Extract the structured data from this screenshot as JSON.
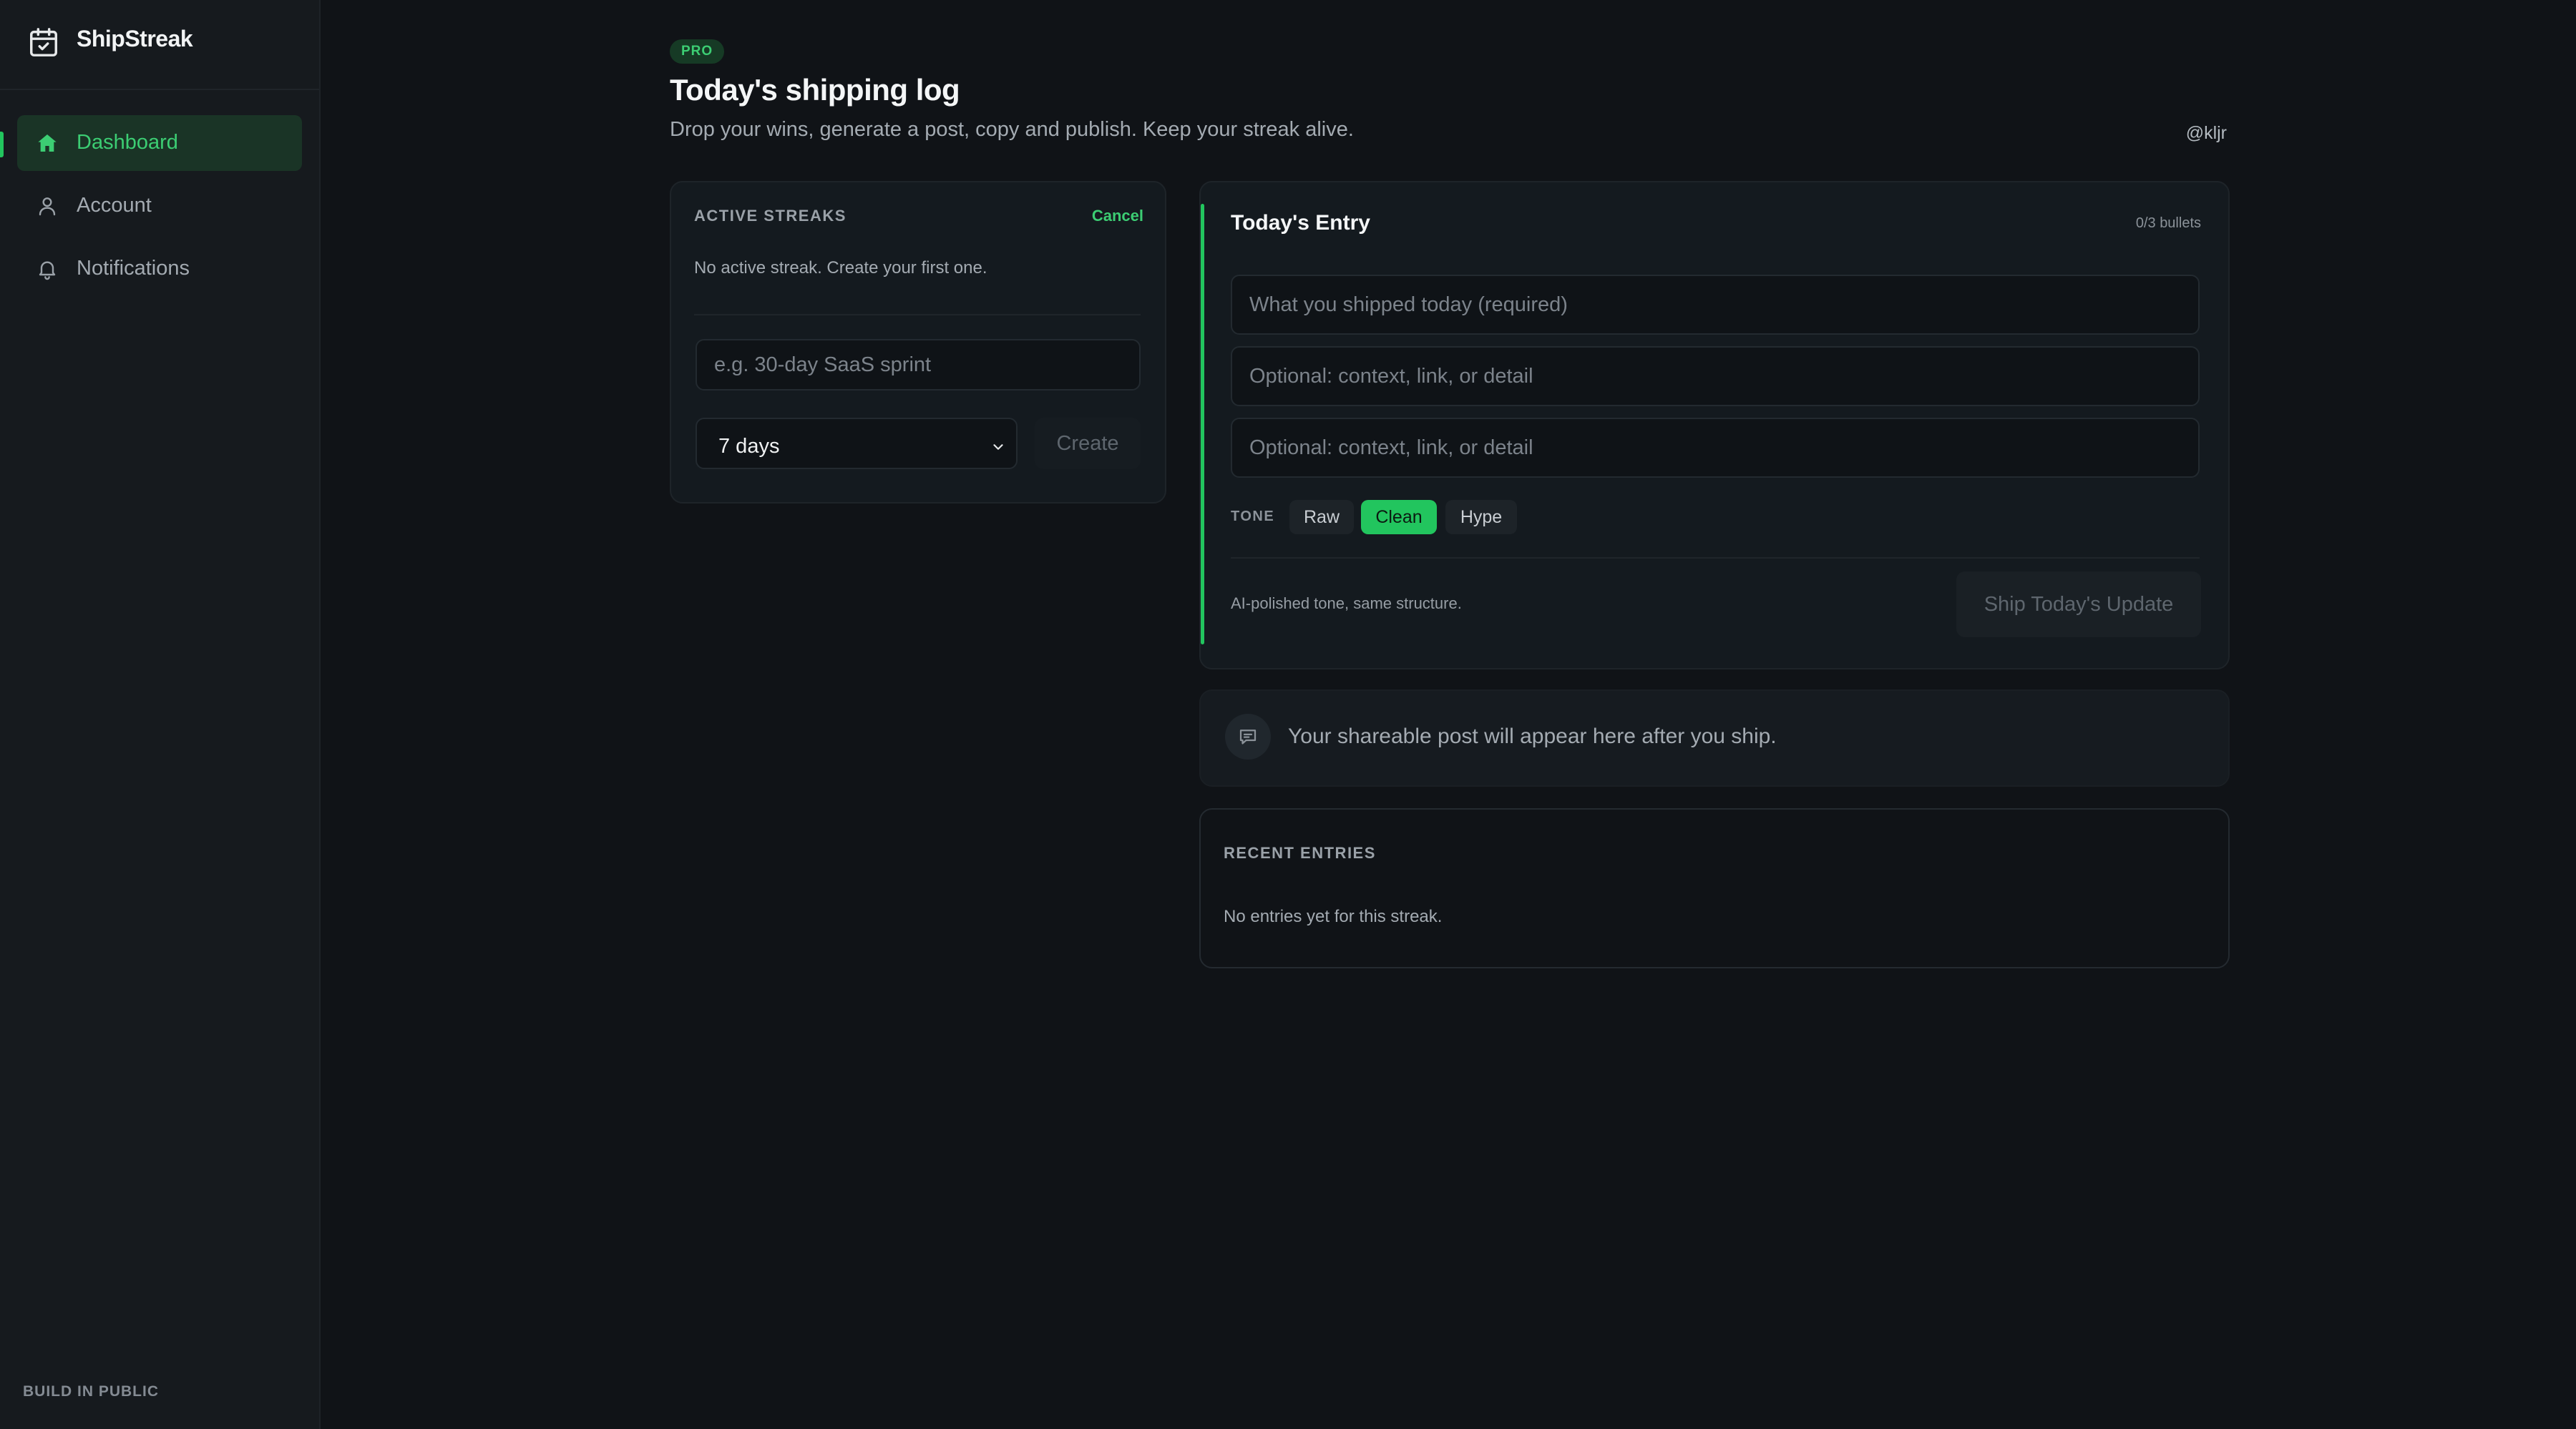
{
  "app": {
    "name": "ShipStreak",
    "footer": "BUILD IN PUBLIC"
  },
  "sidebar": {
    "items": [
      {
        "label": "Dashboard",
        "icon": "home-icon",
        "active": true
      },
      {
        "label": "Account",
        "icon": "user-icon",
        "active": false
      },
      {
        "label": "Notifications",
        "icon": "bell-icon",
        "active": false
      }
    ]
  },
  "header": {
    "badge": "PRO",
    "title": "Today's shipping log",
    "subtitle": "Drop your wins, generate a post, copy and publish. Keep your streak alive.",
    "user_handle": "@kljr"
  },
  "streaks": {
    "label": "ACTIVE STREAKS",
    "cancel": "Cancel",
    "empty": "No active streak. Create your first one.",
    "name_placeholder": "e.g. 30-day SaaS sprint",
    "duration": "7 days",
    "create": "Create"
  },
  "entry": {
    "title": "Today's Entry",
    "bullet_count": "0/3 bullets",
    "inputs": [
      {
        "placeholder": "What you shipped today (required)"
      },
      {
        "placeholder": "Optional: context, link, or detail"
      },
      {
        "placeholder": "Optional: context, link, or detail"
      }
    ],
    "tone_label": "TONE",
    "tones": [
      {
        "label": "Raw",
        "selected": false
      },
      {
        "label": "Clean",
        "selected": true
      },
      {
        "label": "Hype",
        "selected": false
      }
    ],
    "tone_hint": "AI-polished tone, same structure.",
    "ship_button": "Ship Today's Update"
  },
  "share": {
    "text": "Your shareable post will appear here after you ship.",
    "icon": "message-icon"
  },
  "recent": {
    "label": "RECENT ENTRIES",
    "empty": "No entries yet for this streak."
  },
  "colors": {
    "accent": "#22c55e",
    "background": "#101317",
    "sidebar": "#161a1e"
  }
}
